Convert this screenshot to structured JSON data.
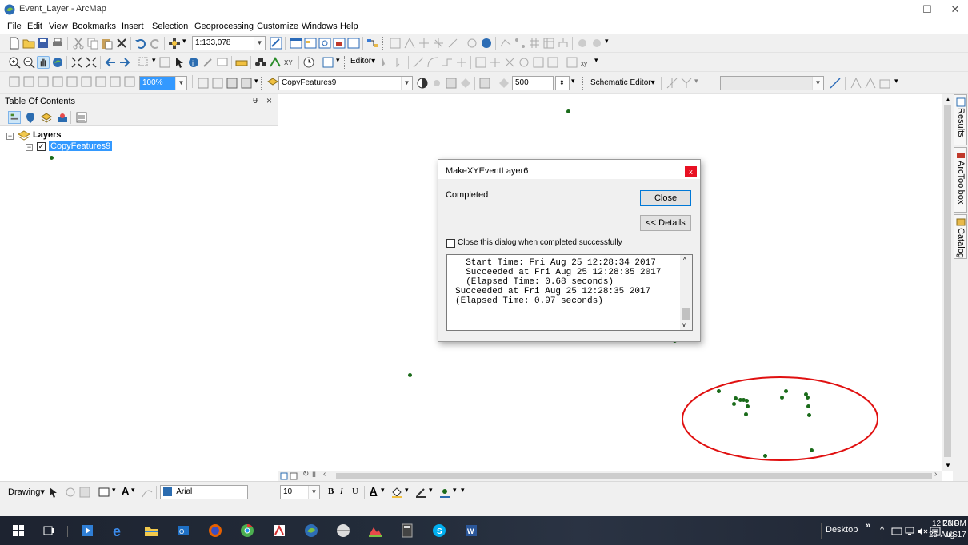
{
  "window": {
    "title": "Event_Layer - ArcMap",
    "minimize": "—",
    "maximize": "☐",
    "close": "✕"
  },
  "menu": [
    "File",
    "Edit",
    "View",
    "Bookmarks",
    "Insert",
    "Selection",
    "Geoprocessing",
    "Customize",
    "Windows",
    "Help"
  ],
  "toolbar": {
    "scale": "1:133,078",
    "editor_label": "Editor▾",
    "layer_combo": "CopyFeatures9",
    "count_value": "500",
    "zoom_percent": "100%",
    "schematic_label": "Schematic Editor▾"
  },
  "toc": {
    "title": "Table Of Contents",
    "pin": "ᵾ",
    "close": "×",
    "group_label": "Layers",
    "layer_label": "CopyFeatures9"
  },
  "side_tabs": [
    "Results",
    "ArcToolbox",
    "Catalog"
  ],
  "dialog": {
    "title": "MakeXYEventLayer6",
    "status": "Completed",
    "close_button": "Close",
    "details_button": "<< Details",
    "checkbox_label": "Close this dialog when completed successfully",
    "log_lines": [
      "  Start Time: Fri Aug 25 12:28:34 2017",
      "  Succeeded at Fri Aug 25 12:28:35 2017",
      "  (Elapsed Time: 0.68 seconds)",
      "Succeeded at Fri Aug 25 12:28:35 2017",
      "(Elapsed Time: 0.97 seconds)"
    ]
  },
  "drawing": {
    "label": "Drawing▾",
    "font": "Arial",
    "size": "10",
    "bold": "B",
    "italic": "I",
    "underline": "U",
    "letter_a": "A"
  },
  "taskbar": {
    "desktop_label": "Desktop",
    "lang": "ENG",
    "region": "US",
    "time": "12:28 PM",
    "date": "25-Aug-17"
  },
  "colors": {
    "point": "#1a6b1a",
    "ellipse": "#e01010",
    "selection": "#3399ff"
  }
}
